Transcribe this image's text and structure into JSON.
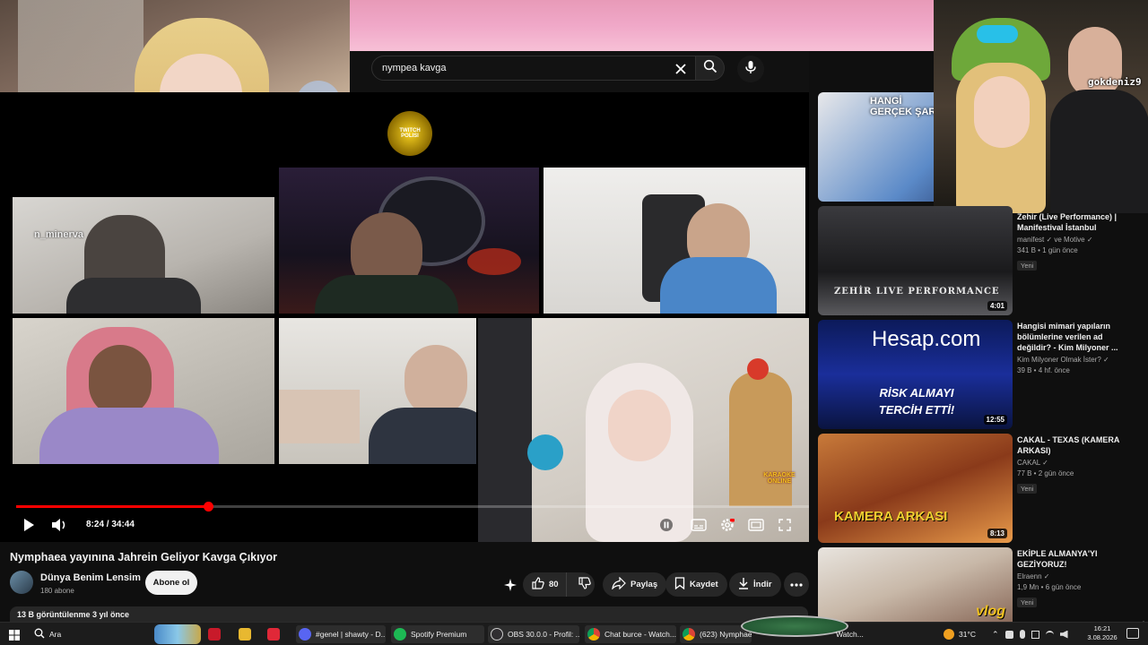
{
  "search": {
    "query": "nympea kavga"
  },
  "overlay": {
    "corner_username": "gokdeniz9",
    "grid_username": "n_minerva",
    "logo_text": "TWITCH POLISI",
    "wm_text": "KARAOKE ONLINE"
  },
  "player": {
    "time": "8:24 / 34:44",
    "progress": 0.242
  },
  "video": {
    "title": "Nymphaea yayınına Jahrein Geliyor Kavga Çıkıyor",
    "channel": "Dünya Benim Lensim",
    "subscribers": "180 abone",
    "subscribe_label": "Abone ol",
    "likes": "80",
    "share_label": "Paylaş",
    "save_label": "Kaydet",
    "download_label": "İndir",
    "views": "13 B görüntülenme  3 yıl önce"
  },
  "related": [
    {
      "title": "",
      "channel": "",
      "meta": "",
      "badge": "",
      "duration": "",
      "thumb_text": "HANGİ GERÇEK ŞAR"
    },
    {
      "title": "Zehir (Live Performance) | Manifestival İstanbul",
      "channel": "manifest ✓ ve Motive ✓",
      "meta": "341 B • 1 gün önce",
      "badge": "Yeni",
      "duration": "4:01",
      "thumb_text": "ZEHİR LIVE PERFORMANCE"
    },
    {
      "title": "Hangisi mimari yapıların bölümlerine verilen ad değildir? - Kim Milyoner ...",
      "channel": "Kim Milyoner Olmak İster? ✓",
      "meta": "39 B • 4 hf. önce",
      "badge": "",
      "duration": "12:55",
      "thumb_text": "RİSK ALMAYI TERCİH ETTİ!",
      "thumb_text_top": "Hesap.com"
    },
    {
      "title": "CAKAL - TEXAS (KAMERA ARKASI)",
      "channel": "CAKAL ✓",
      "meta": "77 B • 2 gün önce",
      "badge": "Yeni",
      "duration": "8:13",
      "thumb_text": "KAMERA ARKASI"
    },
    {
      "title": "EKİPLE ALMANYA'YI GEZİYORUZ!",
      "channel": "Elraenn ✓",
      "meta": "1,9 Mn • 6 gün önce",
      "badge": "Yeni",
      "duration": "",
      "thumb_text": "vlog"
    }
  ],
  "taskbar": {
    "search_label": "Ara",
    "items": [
      "#genel | shawty - D...",
      "Spotify Premium",
      "OBS 30.0.0 - Profil: ...",
      "Chat burce - Watch...",
      "(623) Nymphaea ...",
      "Watch..."
    ],
    "temperature": "31°C",
    "time": "16:21",
    "date": "3.08.2026"
  },
  "colors": {
    "accent": "#ff0000",
    "background": "#0f0f0f",
    "pink_overlay": "#f0a8c8"
  }
}
